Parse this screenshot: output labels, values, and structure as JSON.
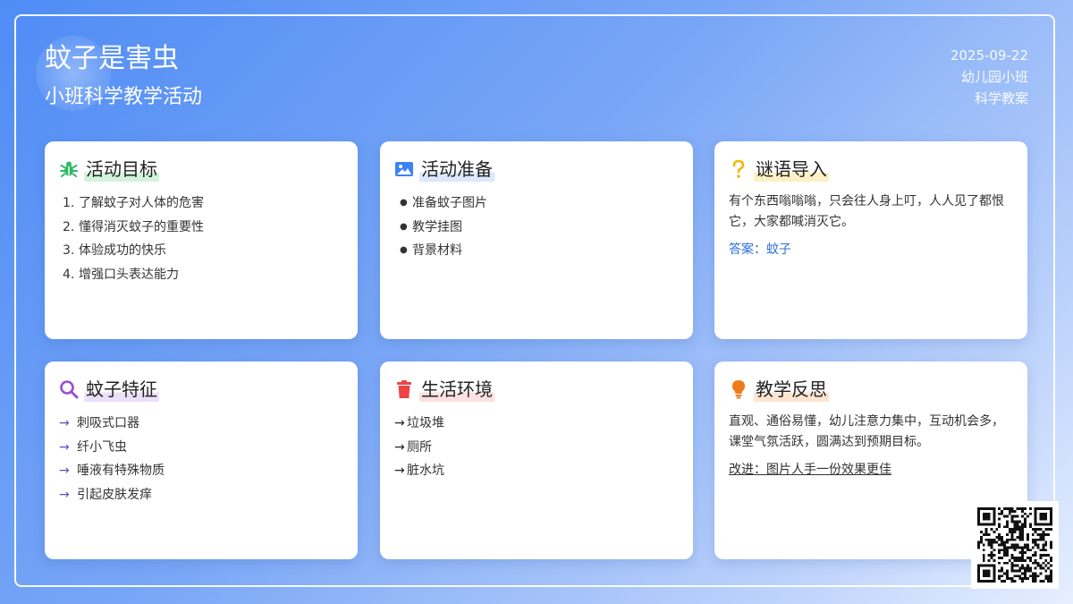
{
  "header": {
    "title": "蚊子是害虫",
    "subtitle": "小班科学教学活动",
    "date": "2025-09-22",
    "grade": "幼儿园小班",
    "type": "科学教案"
  },
  "cards": {
    "goals": {
      "title": "活动目标",
      "icon": "bug-icon",
      "items": [
        "了解蚊子对人体的危害",
        "懂得消灭蚊子的重要性",
        "体验成功的快乐",
        "增强口头表达能力"
      ]
    },
    "prep": {
      "title": "活动准备",
      "icon": "image-icon",
      "items": [
        "准备蚊子图片",
        "教学挂图",
        "背景材料"
      ]
    },
    "riddle": {
      "title": "谜语导入",
      "icon": "question-icon",
      "text": "有个东西嗡嗡嗡，只会往人身上叮，人人见了都恨它，大家都喊消灭它。",
      "answer": "答案：蚊子"
    },
    "features": {
      "title": "蚊子特征",
      "icon": "search-icon",
      "items": [
        "刺吸式口器",
        "纤小飞虫",
        "唾液有特殊物质",
        "引起皮肤发痒"
      ]
    },
    "habitat": {
      "title": "生活环境",
      "icon": "trash-icon",
      "items": [
        "垃圾堆",
        "厕所",
        "脏水坑"
      ]
    },
    "reflection": {
      "title": "教学反思",
      "icon": "lightbulb-icon",
      "text": "直观、通俗易懂，幼儿注意力集中，互动机会多，课堂气氛活跃，圆满达到预期目标。",
      "improve": "改进：图片人手一份效果更佳"
    }
  },
  "colors": {
    "green": "#2fb866",
    "blue": "#3b82f6",
    "yellow": "#f2b70a",
    "purple": "#9b4dd9",
    "red": "#ef4444",
    "orange": "#f07a1a",
    "link": "#2f6fd6"
  }
}
